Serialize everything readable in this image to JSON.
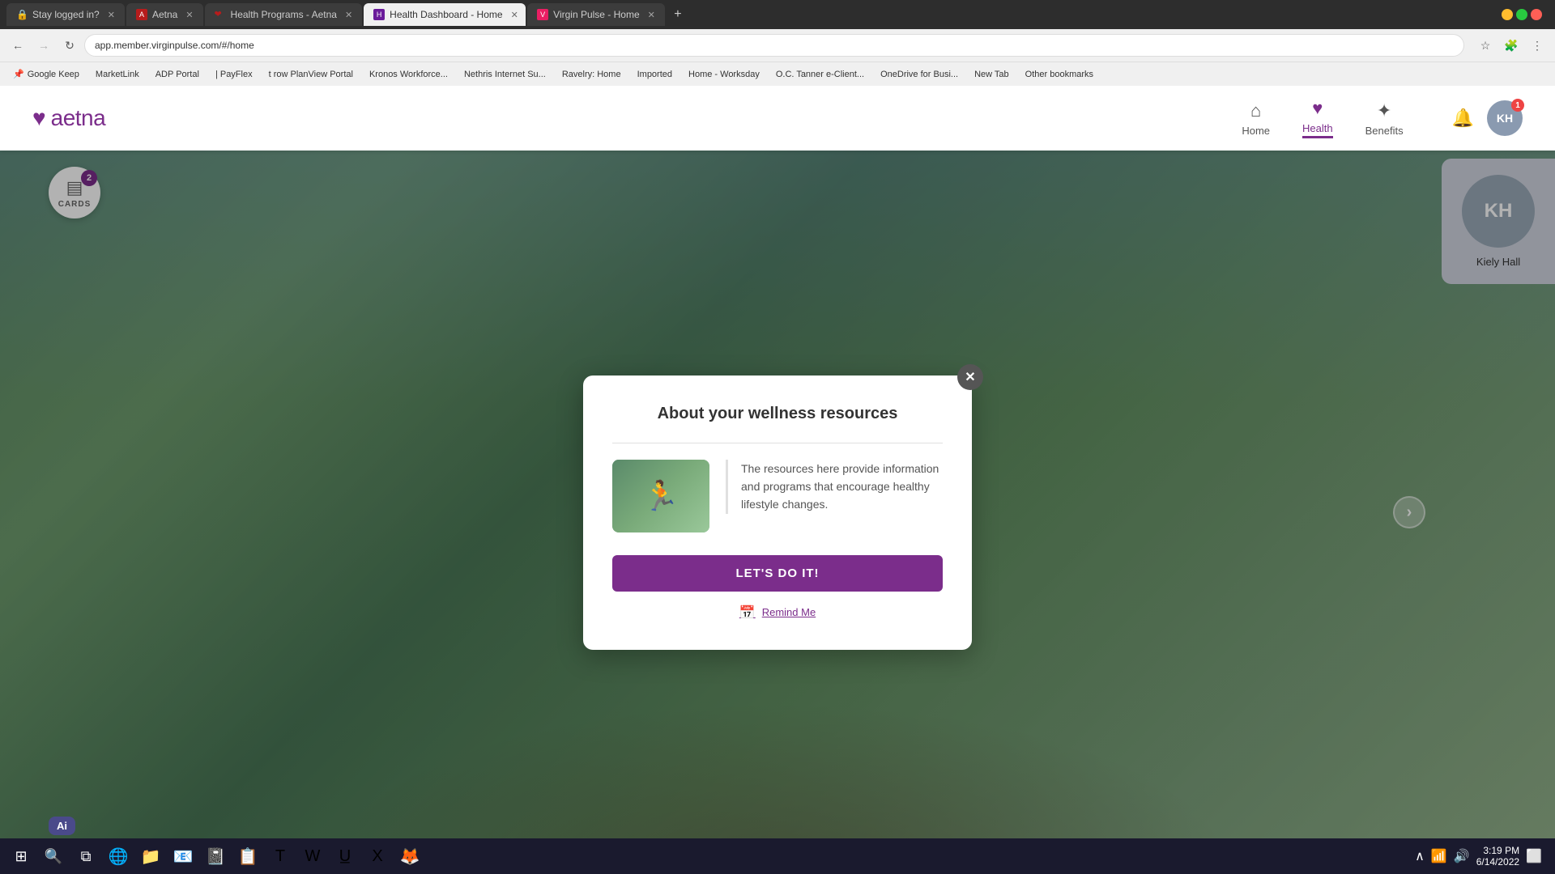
{
  "browser": {
    "tabs": [
      {
        "id": "tab1",
        "title": "Stay logged in?",
        "active": false,
        "favicon": "🔒"
      },
      {
        "id": "tab2",
        "title": "Aetna",
        "active": false,
        "favicon": "A"
      },
      {
        "id": "tab3",
        "title": "Health Programs - Aetna",
        "active": false,
        "favicon": "❤"
      },
      {
        "id": "tab4",
        "title": "Health Dashboard - Home",
        "active": true,
        "favicon": "H"
      },
      {
        "id": "tab5",
        "title": "Virgin Pulse - Home",
        "active": false,
        "favicon": "V"
      }
    ],
    "address": "app.member.virginpulse.com/#/home",
    "bookmarks": [
      "Google Keep",
      "MarketLink",
      "ADP Portal",
      "| PayFlex",
      "t row PlanView Portal",
      "Kronos Workforce...",
      "Nethris Internet Su...",
      "Ravelry: Home",
      "Imported",
      "Home - Worksday",
      "O.C. Tanner e-Client...",
      "OneDrive for Busi...",
      "New Tab",
      "Other bookmarks"
    ]
  },
  "header": {
    "logo_heart": "♥",
    "logo_text": "aetna",
    "nav": {
      "home": "Home",
      "health": "Health",
      "benefits": "Benefits"
    },
    "avatar_initials": "KH",
    "notification_count": "1"
  },
  "cards": {
    "count": "2",
    "label": "CARDS"
  },
  "modal": {
    "title": "About your wellness resources",
    "description": "The resources here provide information and programs that encourage healthy lifestyle changes.",
    "cta_label": "LET'S DO IT!",
    "remind_label": "Remind Me"
  },
  "user_panel": {
    "initials": "KH",
    "name": "Kiely Hall"
  },
  "taskbar": {
    "time": "3:19 PM",
    "date": "6/14/2022",
    "ai_label": "Ai"
  }
}
